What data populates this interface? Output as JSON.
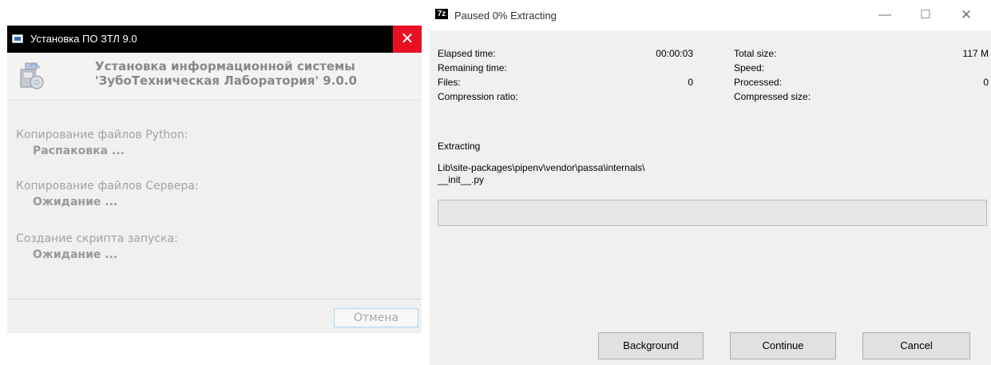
{
  "installer": {
    "title": "Установка ПО ЗТЛ 9.0",
    "close_glyph": "✕",
    "header": {
      "line1": "Установка информационной системы",
      "line2": "'ЗубоТехническая Лаборатория' 9.0.0"
    },
    "steps": [
      {
        "label": "Копирование файлов Python:",
        "status": "Распаковка ..."
      },
      {
        "label": "Копирование файлов Сервера:",
        "status": "Ожидание ..."
      },
      {
        "label": "Создание скрипта запуска:",
        "status": "Ожидание ..."
      }
    ],
    "cancel_label": "Отмена"
  },
  "sevenzip": {
    "icon_text": "7z",
    "title": "Paused 0% Extracting",
    "window_controls": {
      "minimize": "—",
      "maximize": "☐",
      "close": "✕"
    },
    "stats_left": [
      {
        "label": "Elapsed time:",
        "value": "00:00:03"
      },
      {
        "label": "Remaining time:",
        "value": ""
      },
      {
        "label": "Files:",
        "value": "0"
      },
      {
        "label": "Compression ratio:",
        "value": ""
      }
    ],
    "stats_right": [
      {
        "label": "Total size:",
        "value": "117 M"
      },
      {
        "label": "Speed:",
        "value": ""
      },
      {
        "label": "Processed:",
        "value": "0"
      },
      {
        "label": "Compressed size:",
        "value": ""
      }
    ],
    "status_label": "Extracting",
    "current_file_line1": "Lib\\site-packages\\pipenv\\vendor\\passa\\internals\\",
    "current_file_line2": "__init__.py",
    "progress_fraction": 0,
    "buttons": {
      "background": "Background",
      "continue": "Continue",
      "cancel": "Cancel"
    }
  },
  "icons": {
    "installer_app_icon": "window-app-icon",
    "installer_header_icon": "installer-package-icon",
    "sevenzip_icon": "7zip-logo-icon"
  },
  "colors": {
    "close_hover_red": "#e81123",
    "progress_green": "#06b025",
    "focus_border": "#a8d5f2"
  }
}
